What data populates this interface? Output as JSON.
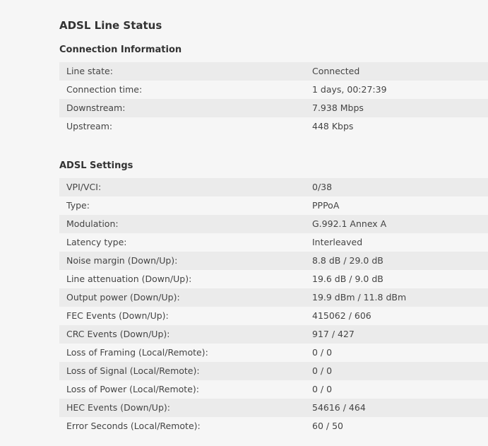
{
  "page_title": "ADSL Line Status",
  "connection": {
    "title": "Connection Information",
    "rows": [
      {
        "label": "Line state:",
        "value": "Connected"
      },
      {
        "label": "Connection time:",
        "value": "1 days, 00:27:39"
      },
      {
        "label": "Downstream:",
        "value": "7.938 Mbps"
      },
      {
        "label": "Upstream:",
        "value": "448 Kbps"
      }
    ]
  },
  "adsl": {
    "title": "ADSL Settings",
    "rows": [
      {
        "label": "VPI/VCI:",
        "value": "0/38"
      },
      {
        "label": "Type:",
        "value": "PPPoA"
      },
      {
        "label": "Modulation:",
        "value": "G.992.1 Annex A"
      },
      {
        "label": "Latency type:",
        "value": "Interleaved"
      },
      {
        "label": "Noise margin (Down/Up):",
        "value": "8.8 dB / 29.0 dB"
      },
      {
        "label": "Line attenuation (Down/Up):",
        "value": "19.6 dB / 9.0 dB"
      },
      {
        "label": "Output power (Down/Up):",
        "value": "19.9 dBm / 11.8 dBm"
      },
      {
        "label": "FEC Events (Down/Up):",
        "value": "415062 / 606"
      },
      {
        "label": "CRC Events (Down/Up):",
        "value": "917 / 427"
      },
      {
        "label": "Loss of Framing (Local/Remote):",
        "value": "0 / 0"
      },
      {
        "label": "Loss of Signal (Local/Remote):",
        "value": "0 / 0"
      },
      {
        "label": "Loss of Power (Local/Remote):",
        "value": "0 / 0"
      },
      {
        "label": "HEC Events (Down/Up):",
        "value": "54616 / 464"
      },
      {
        "label": "Error Seconds (Local/Remote):",
        "value": "60 / 50"
      }
    ]
  }
}
